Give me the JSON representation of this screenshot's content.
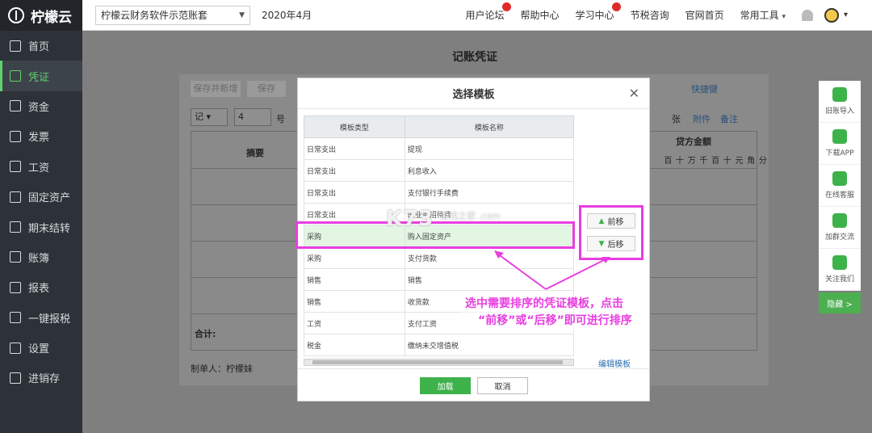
{
  "sidebar": {
    "logo": "柠檬云",
    "items": [
      {
        "label": "首页",
        "active": false
      },
      {
        "label": "凭证",
        "active": true
      },
      {
        "label": "资金",
        "active": false
      },
      {
        "label": "发票",
        "active": false
      },
      {
        "label": "工资",
        "active": false
      },
      {
        "label": "固定资产",
        "active": false
      },
      {
        "label": "期末结转",
        "active": false
      },
      {
        "label": "账簿",
        "active": false
      },
      {
        "label": "报表",
        "active": false
      },
      {
        "label": "一键报税",
        "active": false
      },
      {
        "label": "设置",
        "active": false
      },
      {
        "label": "进销存",
        "active": false
      }
    ]
  },
  "topbar": {
    "account": "柠檬云财务软件示范账套",
    "period": "2020年4月",
    "links": [
      "用户论坛",
      "帮助中心",
      "学习中心",
      "节税咨询",
      "官网首页",
      "常用工具"
    ]
  },
  "page": {
    "title": "记账凭证",
    "save_new_btn": "保存并新增",
    "save_btn": "保存",
    "shortcut": "快捷键",
    "voucher_word": "记",
    "voucher_no": "4",
    "no_suffix": "号",
    "attach_unit": "张",
    "attachment": "附件",
    "remark": "备注",
    "col_summary": "摘要",
    "col_credit": "贷方金额",
    "digits": [
      "百",
      "十",
      "万",
      "千",
      "百",
      "十",
      "元",
      "角",
      "分"
    ],
    "total_label": "合计:",
    "maker": "制单人：柠檬妹"
  },
  "tools": [
    "旧账导入",
    "下载APP",
    "在线客服",
    "加群交流",
    "关注我们"
  ],
  "hide_label": "隐藏 >",
  "modal": {
    "title": "选择模板",
    "headers": [
      "模板类型",
      "模板名称"
    ],
    "rows": [
      {
        "type": "日常支出",
        "name": "提现"
      },
      {
        "type": "日常支出",
        "name": "利息收入"
      },
      {
        "type": "日常支出",
        "name": "支付银行手续费"
      },
      {
        "type": "日常支出",
        "name": "的业务招待费"
      },
      {
        "type": "采购",
        "name": "购入固定资产"
      },
      {
        "type": "采购",
        "name": "支付货款"
      },
      {
        "type": "销售",
        "name": "销售"
      },
      {
        "type": "销售",
        "name": "收货款"
      },
      {
        "type": "工资",
        "name": "支付工资"
      },
      {
        "type": "税金",
        "name": "缴纳未交增值税"
      }
    ],
    "move_up": "前移",
    "move_down": "后移",
    "edit_template": "编辑模板",
    "ok": "加载",
    "cancel": "取消"
  },
  "annotation": {
    "line1": "选中需要排序的凭证模板，点击",
    "line2": "“前移”或“后移”即可进行排序"
  },
  "watermark": {
    "main": "K73",
    "sub": "游戏之家 .com"
  },
  "colors": {
    "accent": "#3db24b",
    "annotation": "#e83ee0",
    "sidebar_bg": "#2d3238"
  }
}
